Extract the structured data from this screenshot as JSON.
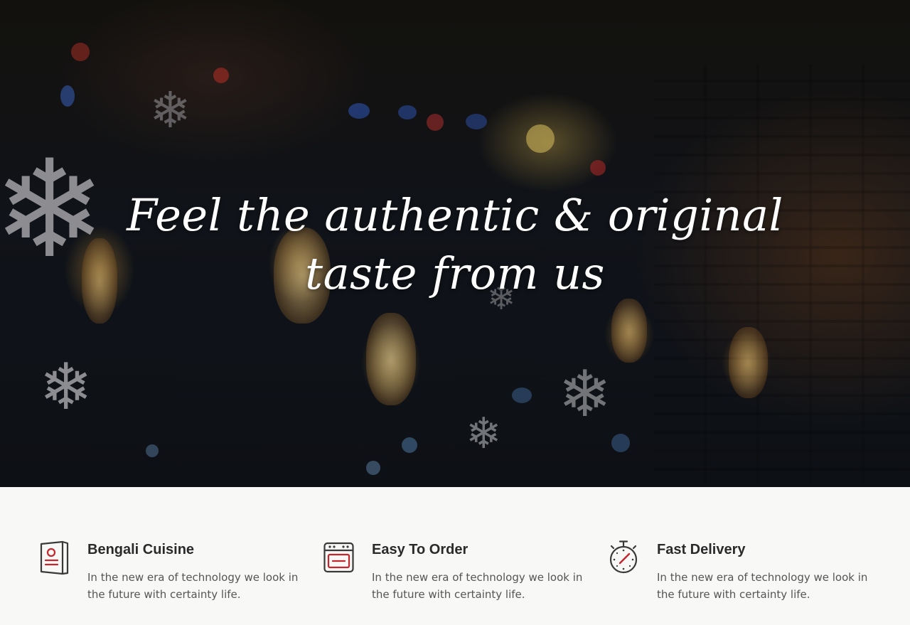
{
  "hero": {
    "title_line1": "Feel the authentic & original",
    "title_line2": "taste from us"
  },
  "features": [
    {
      "icon": "menu-book-icon",
      "title": "Bengali Cuisine",
      "desc": "In the new era of technology we look in the future with certainty life."
    },
    {
      "icon": "oven-icon",
      "title": "Easy To Order",
      "desc": "In the new era of technology we look in the future with certainty life."
    },
    {
      "icon": "stopwatch-icon",
      "title": "Fast Delivery",
      "desc": "In the new era of technology we look in the future with certainty life."
    }
  ],
  "colors": {
    "accent": "#c1272d",
    "icon_stroke": "#3a3a3a",
    "heading": "#2a2a2a",
    "body_text": "#555555",
    "section_bg": "#f8f8f6"
  }
}
